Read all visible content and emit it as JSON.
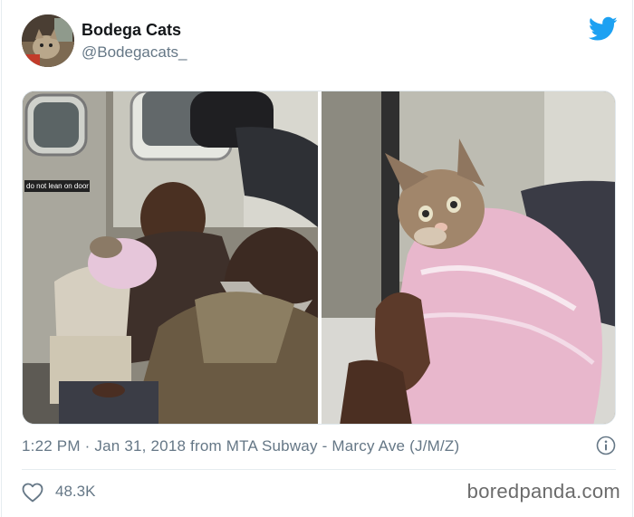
{
  "tweet": {
    "author": {
      "display_name": "Bodega Cats",
      "handle": "@Bodegacats_",
      "avatar_icon": "cat-avatar"
    },
    "brand_icon": "twitter-bird-icon",
    "brand_color": "#1da1f2",
    "media": {
      "left_photo": {
        "subject": "two men on subway holding kitten in pink blanket",
        "door_sticker_text": "do not lean on door"
      },
      "right_photo": {
        "subject": "kitten wrapped in pink crochet blanket"
      }
    },
    "timestamp": "1:22 PM · Jan 31, 2018 from MTA Subway - Marcy Ave (J/M/Z)",
    "info_icon": "info-icon",
    "likes": {
      "icon": "heart-icon",
      "count": "48.3K"
    }
  },
  "watermark": "boredpanda.com"
}
